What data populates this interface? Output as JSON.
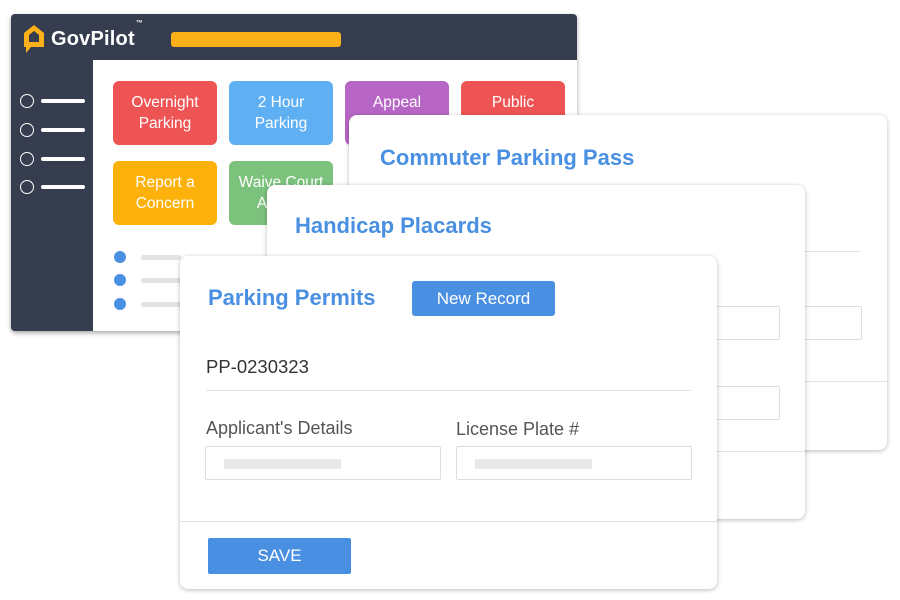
{
  "app": {
    "brand": "GovPilot",
    "trademark": "™",
    "colors": {
      "header_bg": "#353d4f",
      "search_bar": "#fbb117",
      "accent": "#4a90e2"
    },
    "sidebar": {
      "items": [
        {
          "icon": "radio-circle-icon"
        },
        {
          "icon": "radio-circle-icon"
        },
        {
          "icon": "radio-circle-icon"
        },
        {
          "icon": "radio-circle-icon"
        }
      ]
    },
    "tiles": [
      {
        "label": "Overnight Parking",
        "color": "#ef5455"
      },
      {
        "label": "2 Hour Parking",
        "color": "#5fb0f3"
      },
      {
        "label": "Appeal",
        "color": "#b866c5"
      },
      {
        "label": "Public",
        "color": "#ef5455"
      },
      {
        "label": "Report a Concern",
        "color": "#fdb10b"
      },
      {
        "label": "Waive Court Appeal",
        "color": "#7cc27d"
      }
    ],
    "list_items": [
      {
        "icon": "bullet-dot-icon"
      },
      {
        "icon": "bullet-dot-icon"
      },
      {
        "icon": "bullet-dot-icon"
      }
    ]
  },
  "cards": {
    "commuter": {
      "title": "Commuter Parking Pass"
    },
    "handicap": {
      "title": "Handicap Placards"
    },
    "permits": {
      "title": "Parking Permits",
      "new_record_label": "New Record",
      "record_id": "PP-0230323",
      "fields": [
        {
          "label": "Applicant's Details",
          "value": ""
        },
        {
          "label": "License Plate #",
          "value": ""
        }
      ],
      "save_label": "SAVE"
    }
  }
}
